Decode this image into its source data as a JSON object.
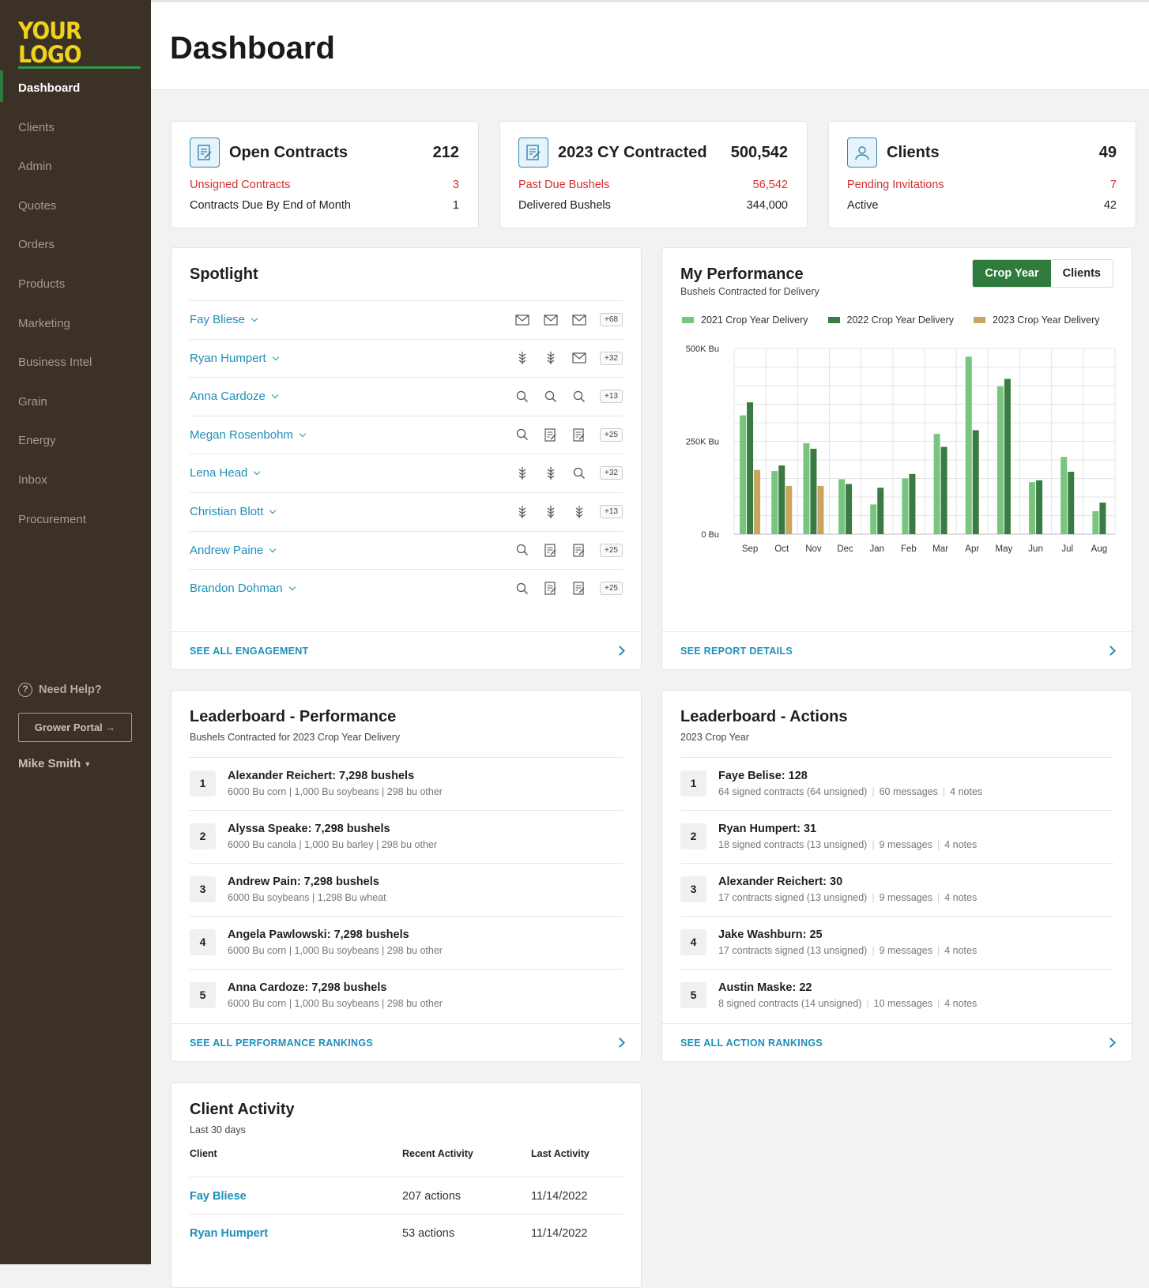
{
  "brand": {
    "logo": "YOUR LOGO"
  },
  "nav": [
    "Dashboard",
    "Clients",
    "Admin",
    "Quotes",
    "Orders",
    "Products",
    "Marketing",
    "Business Intel",
    "Grain",
    "Energy",
    "Inbox",
    "Procurement"
  ],
  "help": {
    "label": "Need Help?",
    "icon": "question-icon"
  },
  "portal": {
    "label": "Grower Portal →"
  },
  "user": {
    "name": "Mike Smith"
  },
  "page": {
    "title": "Dashboard"
  },
  "stats": [
    {
      "title": "Open Contracts",
      "value": "212",
      "icon": "contract-icon",
      "rows": [
        {
          "label": "Unsigned Contracts",
          "value": "3",
          "alert": true
        },
        {
          "label": "Contracts Due By End of Month",
          "value": "1",
          "alert": false
        }
      ]
    },
    {
      "title": "2023 CY Contracted",
      "value": "500,542",
      "icon": "contract-icon",
      "rows": [
        {
          "label": "Past Due Bushels",
          "value": "56,542",
          "alert": true
        },
        {
          "label": "Delivered Bushels",
          "value": "344,000",
          "alert": false
        }
      ]
    },
    {
      "title": "Clients",
      "value": "49",
      "icon": "user-icon",
      "rows": [
        {
          "label": "Pending Invitations",
          "value": "7",
          "alert": true
        },
        {
          "label": "Active",
          "value": "42",
          "alert": false
        }
      ]
    }
  ],
  "spotlight": {
    "title": "Spotlight",
    "footer": "SEE ALL ENGAGEMENT",
    "rows": [
      {
        "name": "Fay Bliese",
        "icons": [
          "mail-icon",
          "mail-icon",
          "mail-icon"
        ],
        "badge": "+68"
      },
      {
        "name": "Ryan Humpert",
        "icons": [
          "wheat-icon",
          "wheat-icon",
          "mail-icon"
        ],
        "badge": "+32"
      },
      {
        "name": "Anna Cardoze",
        "icons": [
          "search-icon",
          "search-icon",
          "search-icon"
        ],
        "badge": "+13"
      },
      {
        "name": "Megan Rosenbohm",
        "icons": [
          "search-icon",
          "contract-icon",
          "contract-icon"
        ],
        "badge": "+25"
      },
      {
        "name": "Lena Head",
        "icons": [
          "wheat-icon",
          "wheat-icon",
          "search-icon"
        ],
        "badge": "+32"
      },
      {
        "name": "Christian Blott",
        "icons": [
          "wheat-icon",
          "wheat-icon",
          "wheat-icon"
        ],
        "badge": "+13"
      },
      {
        "name": "Andrew Paine",
        "icons": [
          "search-icon",
          "contract-icon",
          "contract-icon"
        ],
        "badge": "+25"
      },
      {
        "name": "Brandon Dohman",
        "icons": [
          "search-icon",
          "contract-icon",
          "contract-icon"
        ],
        "badge": "+25"
      }
    ]
  },
  "performance": {
    "title": "My Performance",
    "subtitle": "Bushels Contracted for Delivery",
    "toggle": [
      "Crop Year",
      "Clients"
    ],
    "footer": "SEE REPORT DETAILS"
  },
  "chart_data": {
    "type": "bar",
    "categories": [
      "Sep",
      "Oct",
      "Nov",
      "Dec",
      "Jan",
      "Feb",
      "Mar",
      "Apr",
      "May",
      "Jun",
      "Jul",
      "Aug"
    ],
    "series": [
      {
        "name": "2021 Crop Year Delivery",
        "color": "#77c57e",
        "values": [
          320,
          170,
          245,
          148,
          80,
          150,
          270,
          478,
          398,
          140,
          208,
          62
        ]
      },
      {
        "name": "2022 Crop Year Delivery",
        "color": "#3a7a43",
        "values": [
          355,
          185,
          230,
          135,
          125,
          162,
          235,
          280,
          418,
          145,
          168,
          85
        ]
      },
      {
        "name": "2023 Crop Year Delivery",
        "color": "#c8a661",
        "values": [
          173,
          130,
          130,
          null,
          null,
          null,
          null,
          null,
          null,
          null,
          null,
          null
        ]
      }
    ],
    "yticks": [
      "500K Bu",
      "250K Bu",
      "0 Bu"
    ],
    "ylim": [
      0,
      500
    ],
    "legend": "top",
    "grid": true
  },
  "lb_perf": {
    "title": "Leaderboard - Performance",
    "subtitle": "Bushels Contracted for 2023 Crop Year Delivery",
    "footer": "SEE ALL PERFORMANCE RANKINGS",
    "rows": [
      {
        "rank": "1",
        "main": "Alexander Reichert: 7,298 bushels",
        "detail": "6000 Bu corn | 1,000 Bu soybeans | 298 bu other"
      },
      {
        "rank": "2",
        "main": "Alyssa Speake: 7,298 bushels",
        "detail": "6000 Bu canola | 1,000 Bu barley | 298 bu other"
      },
      {
        "rank": "3",
        "main": "Andrew Pain: 7,298 bushels",
        "detail": "6000 Bu soybeans | 1,298 Bu wheat"
      },
      {
        "rank": "4",
        "main": "Angela Pawlowski: 7,298 bushels",
        "detail": "6000 Bu corn | 1,000 Bu soybeans | 298 bu other"
      },
      {
        "rank": "5",
        "main": "Anna Cardoze: 7,298 bushels",
        "detail": "6000 Bu corn | 1,000 Bu soybeans | 298 bu other"
      }
    ]
  },
  "lb_act": {
    "title": "Leaderboard - Actions",
    "subtitle": "2023 Crop Year",
    "footer": "SEE ALL ACTION RANKINGS",
    "rows": [
      {
        "rank": "1",
        "main": "Faye Belise: 128",
        "d1": "64 signed contracts (64 unsigned)",
        "d2": "60 messages",
        "d3": "4 notes"
      },
      {
        "rank": "2",
        "main": "Ryan Humpert: 31",
        "d1": "18 signed contracts (13 unsigned)",
        "d2": "9 messages",
        "d3": "4 notes"
      },
      {
        "rank": "3",
        "main": "Alexander Reichert: 30",
        "d1": "17 contracts signed (13 unsigned)",
        "d2": "9 messages",
        "d3": "4 notes"
      },
      {
        "rank": "4",
        "main": "Jake Washburn: 25",
        "d1": "17 contracts signed (13 unsigned)",
        "d2": "9 messages",
        "d3": "4 notes"
      },
      {
        "rank": "5",
        "main": "Austin Maske: 22",
        "d1": "8 signed contracts (14 unsigned)",
        "d2": "10 messages",
        "d3": "4 notes"
      }
    ]
  },
  "activity": {
    "title": "Client Activity",
    "subtitle": "Last 30 days",
    "headers": [
      "Client",
      "Recent Activity",
      "Last Activity"
    ],
    "rows": [
      {
        "client": "Fay Bliese",
        "actions": "207 actions",
        "date": "11/14/2022"
      },
      {
        "client": "Ryan Humpert",
        "actions": "53 actions",
        "date": "11/14/2022"
      }
    ]
  }
}
